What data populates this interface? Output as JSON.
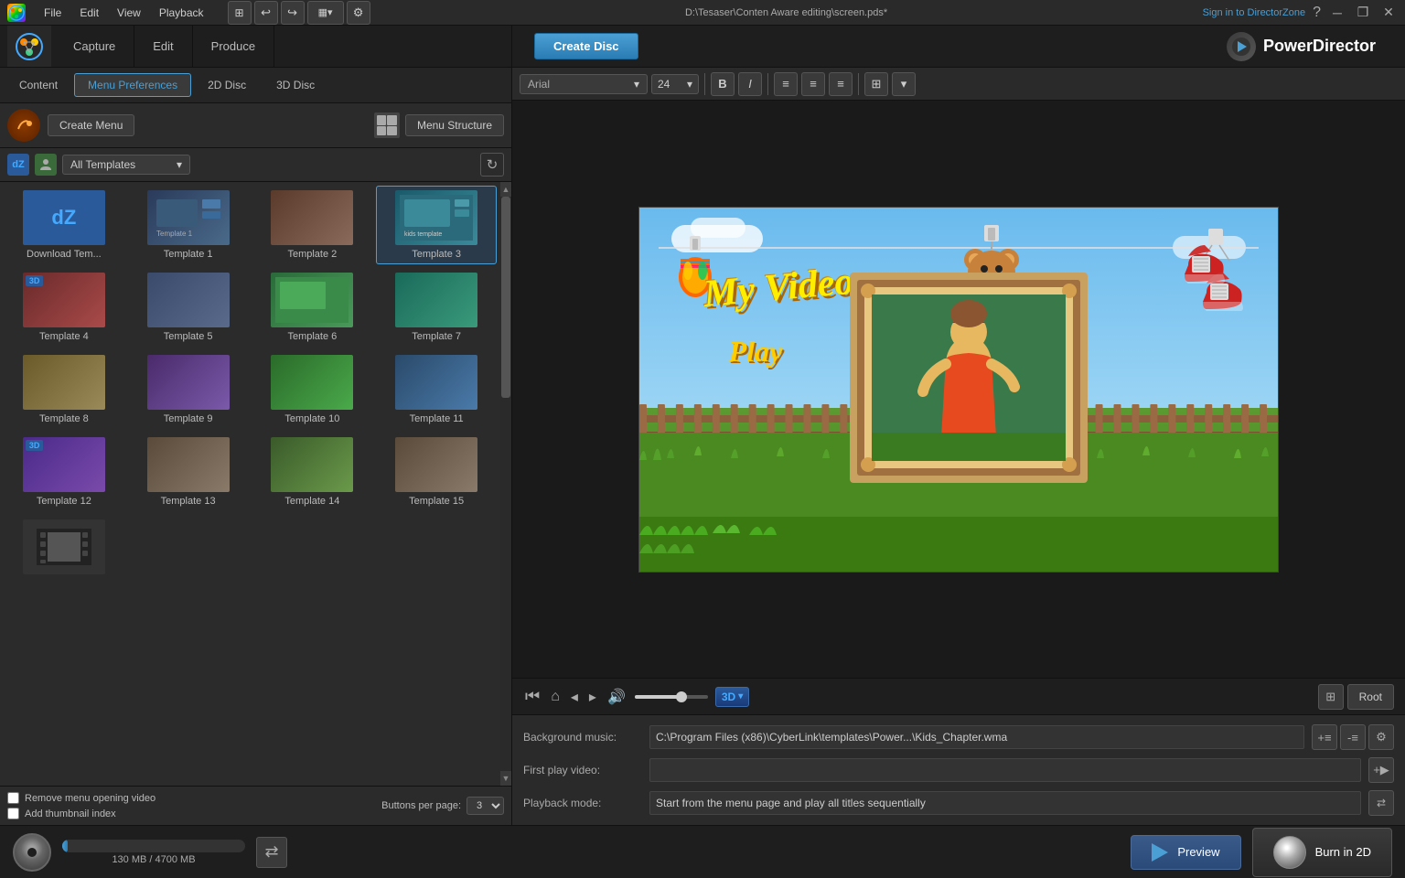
{
  "app": {
    "title": "PowerDirector",
    "file_path": "D:\\Tesaser\\Conten Aware editing\\screen.pds*",
    "sign_in": "Sign in to DirectorZone"
  },
  "titlebar": {
    "menu_items": [
      "File",
      "Edit",
      "View",
      "Playback"
    ],
    "minimize": "─",
    "restore": "❐",
    "close": "✕"
  },
  "header": {
    "capture": "Capture",
    "edit": "Edit",
    "produce": "Produce",
    "create_disc": "Create Disc"
  },
  "subtabs": {
    "content": "Content",
    "menu_preferences": "Menu Preferences",
    "disc_2d": "2D Disc",
    "disc_3d": "3D Disc"
  },
  "menu_row": {
    "create_menu": "Create Menu",
    "menu_structure": "Menu Structure"
  },
  "filter": {
    "all_templates": "All Templates"
  },
  "templates": [
    {
      "id": "download",
      "label": "Download Tem..."
    },
    {
      "id": "1",
      "label": "Template 1"
    },
    {
      "id": "2",
      "label": "Template 2"
    },
    {
      "id": "3",
      "label": "Template 3"
    },
    {
      "id": "4",
      "label": "Template 4"
    },
    {
      "id": "5",
      "label": "Template 5"
    },
    {
      "id": "6",
      "label": "Template 6"
    },
    {
      "id": "7",
      "label": "Template 7"
    },
    {
      "id": "8",
      "label": "Template 8"
    },
    {
      "id": "9",
      "label": "Template 9"
    },
    {
      "id": "10",
      "label": "Template 10"
    },
    {
      "id": "11",
      "label": "Template 11"
    },
    {
      "id": "12",
      "label": "Template 12"
    },
    {
      "id": "13",
      "label": "Template 13"
    },
    {
      "id": "14",
      "label": "Template 14"
    },
    {
      "id": "15",
      "label": "Template 15"
    },
    {
      "id": "extra",
      "label": ""
    }
  ],
  "preview": {
    "title_text": "My Videos",
    "play_text": "Play"
  },
  "playback": {
    "volume_label": "🔊",
    "badge_3d": "3D",
    "root": "Root"
  },
  "info": {
    "background_music_label": "Background music:",
    "background_music_value": "C:\\Program Files (x86)\\CyberLink\\templates\\Power...\\Kids_Chapter.wma",
    "first_play_label": "First play video:",
    "first_play_value": "",
    "playback_mode_label": "Playback mode:",
    "playback_mode_value": "Start from the menu page and play all titles sequentially"
  },
  "bottom": {
    "remove_menu_video": "Remove menu opening video",
    "add_thumbnail": "Add thumbnail index",
    "buttons_per_page_label": "Buttons per page:",
    "buttons_per_page_value": "3",
    "progress": "130 MB / 4700 MB",
    "preview_btn": "Preview",
    "burn_btn": "Burn in 2D"
  }
}
